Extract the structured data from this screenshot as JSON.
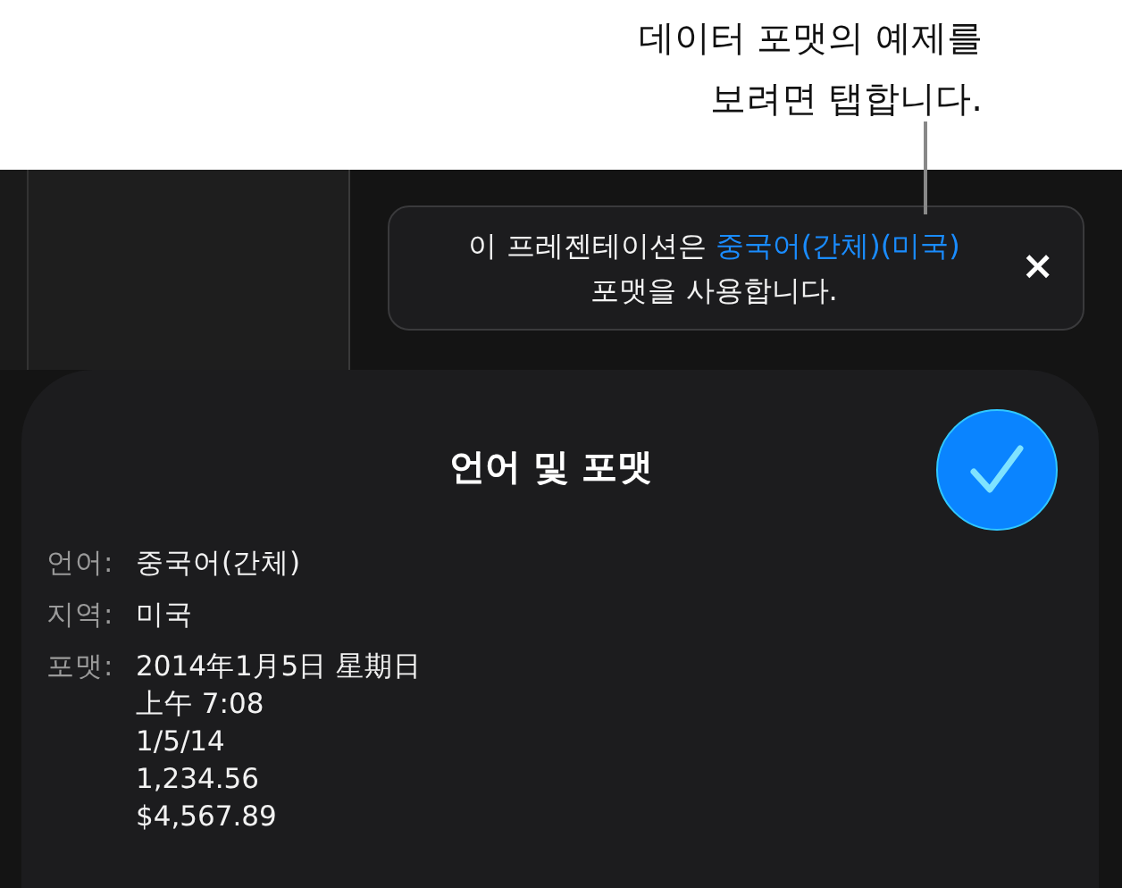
{
  "callout": {
    "lines": [
      "데이터 포맷의 예제를",
      "보려면 탭합니다."
    ]
  },
  "banner": {
    "text_before": "이 프레젠테이션은 ",
    "link": "중국어(간체)(미국)",
    "text_after": " 포맷을 사용합니다.",
    "close": "×"
  },
  "sheet": {
    "title": "언어 및 포맷",
    "done_selected": true,
    "fields": [
      {
        "label": "언어:",
        "values": [
          "중국어(간체)"
        ]
      },
      {
        "label": "지역:",
        "values": [
          "미국"
        ]
      },
      {
        "label": "포맷:",
        "values": [
          "2014年1月5日 星期日",
          "上午 7:08",
          "1/5/14",
          "1,234.56",
          "$4,567.89"
        ]
      }
    ]
  }
}
